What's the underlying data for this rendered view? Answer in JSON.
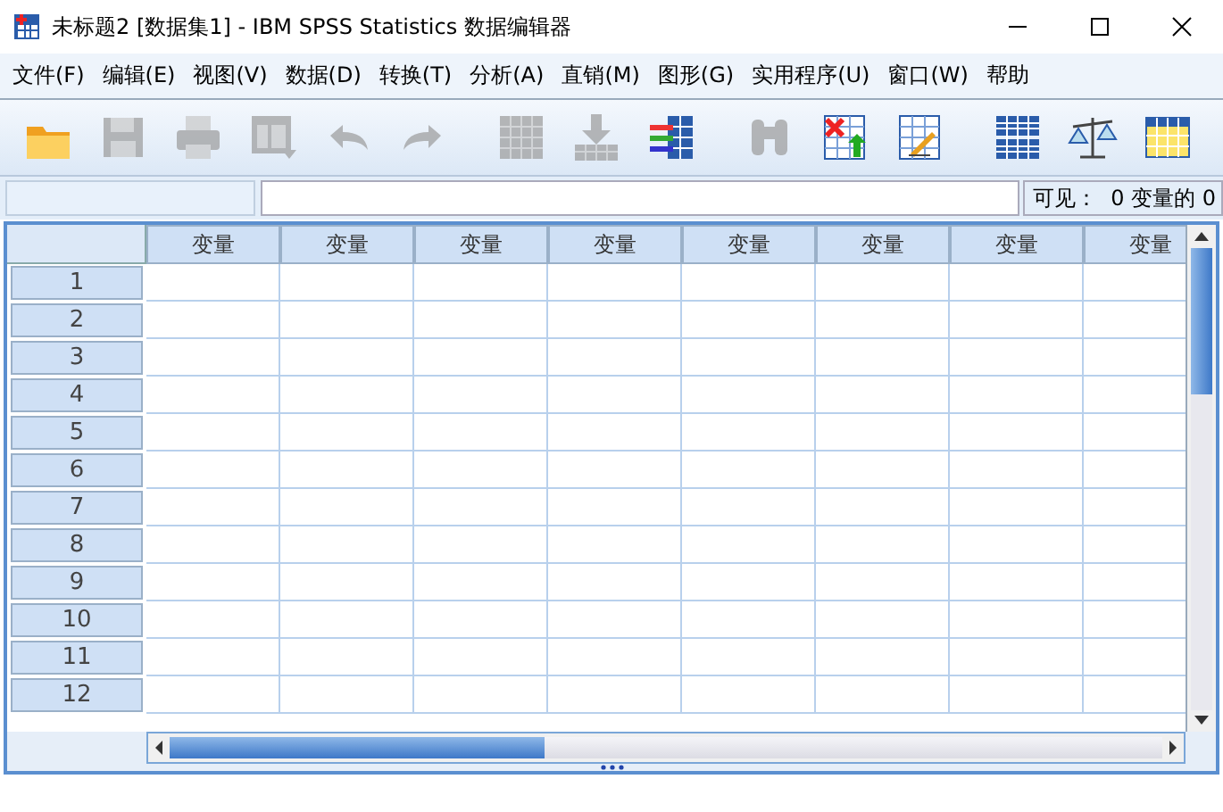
{
  "window": {
    "title": "未标题2 [数据集1] - IBM SPSS Statistics 数据编辑器"
  },
  "menu": [
    "文件(F)",
    "编辑(E)",
    "视图(V)",
    "数据(D)",
    "转换(T)",
    "分析(A)",
    "直销(M)",
    "图形(G)",
    "实用程序(U)",
    "窗口(W)",
    "帮助"
  ],
  "toolbar": [
    {
      "kind": "folder",
      "disabled": false
    },
    {
      "kind": "disk",
      "disabled": true
    },
    {
      "kind": "printer",
      "disabled": true
    },
    {
      "kind": "dialog",
      "disabled": true
    },
    {
      "kind": "undo",
      "disabled": true
    },
    {
      "kind": "redo",
      "disabled": true
    },
    {
      "kind": "grid",
      "disabled": true
    },
    {
      "kind": "download",
      "disabled": true
    },
    {
      "kind": "variables",
      "disabled": false
    },
    {
      "kind": "binoculars",
      "disabled": true
    },
    {
      "kind": "insert",
      "disabled": false
    },
    {
      "kind": "edit",
      "disabled": false
    },
    {
      "kind": "split",
      "disabled": false
    },
    {
      "kind": "scale",
      "disabled": false
    },
    {
      "kind": "select",
      "disabled": false
    }
  ],
  "visible_count": "可见：  0 变量的 0",
  "columns": [
    "变量",
    "变量",
    "变量",
    "变量",
    "变量",
    "变量",
    "变量",
    "变量"
  ],
  "rows": [
    "1",
    "2",
    "3",
    "4",
    "5",
    "6",
    "7",
    "8",
    "9",
    "10",
    "11",
    "12"
  ]
}
